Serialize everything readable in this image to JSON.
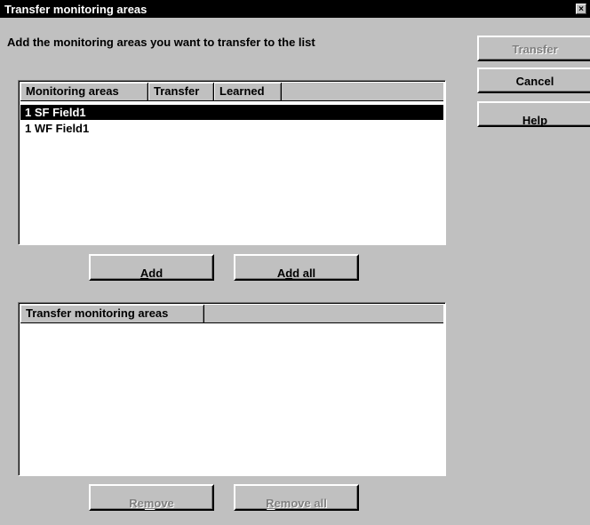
{
  "window": {
    "title": "Transfer monitoring areas",
    "close_glyph": "×"
  },
  "instruction": "Add the monitoring areas you want to transfer to the list",
  "buttons": {
    "transfer": "Transfer",
    "cancel": "Cancel",
    "help_underline": "H",
    "help_rest": "elp",
    "add_underline": "A",
    "add_rest": "dd",
    "addall_pre": "A",
    "addall_underline": "d",
    "addall_rest": "d all",
    "remove_pre": "Re",
    "remove_underline": "m",
    "remove_rest": "ove",
    "removeall_underline": "R",
    "removeall_rest": "emove all"
  },
  "source_list": {
    "columns": [
      "Monitoring areas",
      "Transfer",
      "Learned"
    ],
    "rows": [
      "1 SF Field1",
      "1 WF Field1"
    ],
    "selected_index": 0
  },
  "target_list": {
    "columns": [
      "Transfer monitoring areas"
    ],
    "rows": []
  }
}
